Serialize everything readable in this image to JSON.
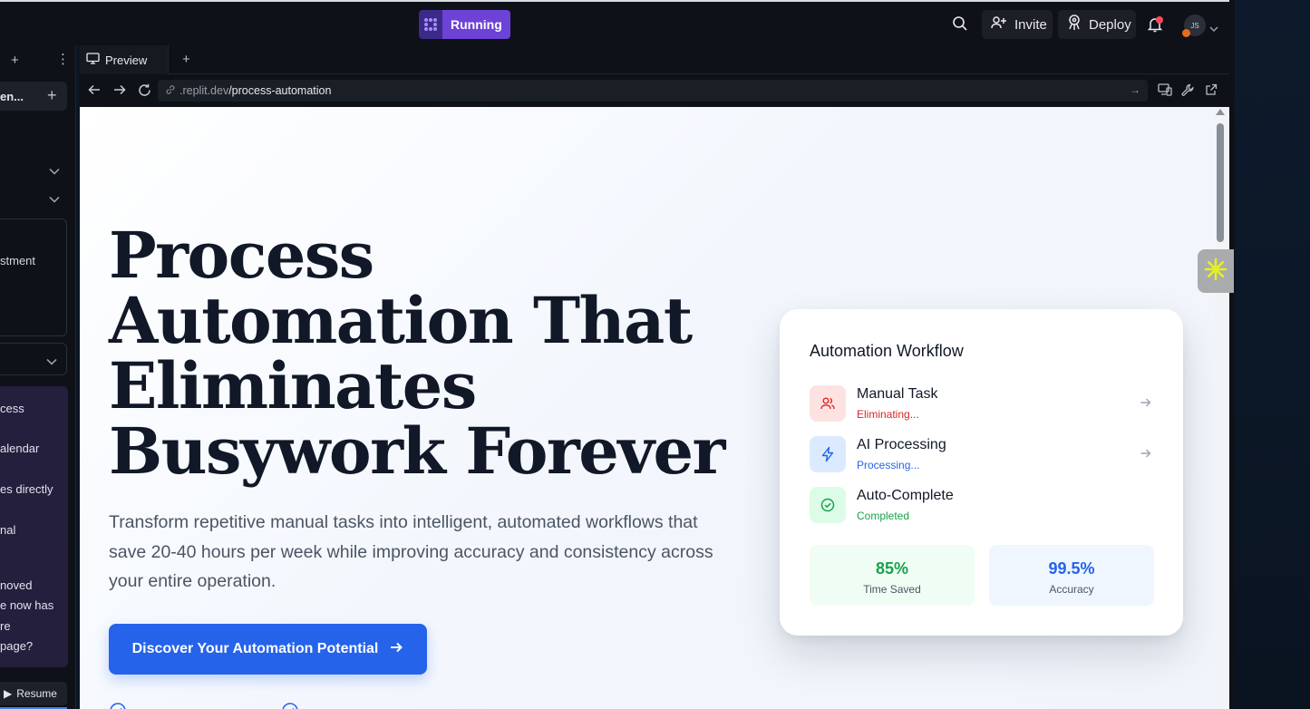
{
  "topbar": {
    "status_label": "Running",
    "invite_label": "Invite",
    "deploy_label": "Deploy",
    "avatar_initials": "JS"
  },
  "left_panel": {
    "tab_chip_label": "en...",
    "box_text": "stment",
    "messages": [
      "cess",
      "alendar",
      "es directly",
      "nal",
      "noved",
      "e now has",
      "re",
      "page?"
    ],
    "resume_label": "Resume"
  },
  "preview": {
    "tab_label": "Preview",
    "url_host": ".replit.dev",
    "url_path": "/process-automation"
  },
  "hero": {
    "title": "Process Automation That Eliminates Busywork Forever",
    "subtitle": "Transform repetitive manual tasks into intelligent, automated workflows that save 20-40 hours per week while improving accuracy and consistency across your entire operation.",
    "cta_label": "Discover Your Automation Potential"
  },
  "card": {
    "title": "Automation Workflow",
    "steps": [
      {
        "name": "Manual Task",
        "status": "Eliminating...",
        "color": "#dc2626",
        "bg": "#fee2e2",
        "icon": "users-icon"
      },
      {
        "name": "AI Processing",
        "status": "Processing...",
        "color": "#2563eb",
        "bg": "#dbeafe",
        "icon": "lightning-icon"
      },
      {
        "name": "Auto-Complete",
        "status": "Completed",
        "color": "#16a34a",
        "bg": "#dcfce7",
        "icon": "check-circle-icon"
      }
    ],
    "stats": [
      {
        "value": "85%",
        "label": "Time Saved",
        "color": "#16a34a",
        "bg": "#f0fdf4"
      },
      {
        "value": "99.5%",
        "label": "Accuracy",
        "color": "#2563eb",
        "bg": "#eff6ff"
      }
    ]
  },
  "colors": {
    "accent": "#2563eb",
    "running": "#6d42d6"
  }
}
